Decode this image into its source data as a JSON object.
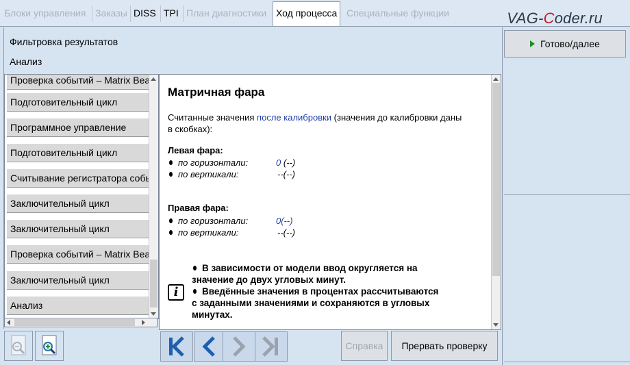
{
  "tabs": [
    {
      "label": "Блоки управления",
      "state": "disabled"
    },
    {
      "label": "Заказы",
      "state": "disabled"
    },
    {
      "label": "DISS",
      "state": "normal"
    },
    {
      "label": "TPI",
      "state": "normal"
    },
    {
      "label": "План диагностики",
      "state": "disabled"
    },
    {
      "label": "Ход процесса",
      "state": "active"
    },
    {
      "label": "Специальные функции",
      "state": "disabled"
    }
  ],
  "logo": {
    "prefix": "VAG-",
    "accent": "C",
    "suffix": "oder.ru"
  },
  "left_header": {
    "filter_label": "Фильтровка результатов",
    "analysis_label": "Анализ"
  },
  "list_items": [
    "Проверка событий – Matrix Beam",
    "Подготовительный цикл",
    "Программное управление",
    "Подготовительный цикл",
    "Считывание регистратора событий",
    "Заключительный цикл",
    "Заключительный цикл",
    "Проверка событий – Matrix Beam",
    "Заключительный цикл",
    "Анализ"
  ],
  "content": {
    "title": "Матричная фара",
    "intro_part1": "Считанные значения ",
    "intro_link": "после калибровки",
    "intro_part2": " (значения до калибровки даны",
    "intro_line2": "в скобках):",
    "left_heading": "Левая фара:",
    "left_h_label": "по горизонтали:",
    "left_h_value": "0",
    "left_h_prev": "(--)",
    "left_v_label": "по вертикали:",
    "left_v_value": "--(--)",
    "right_heading": "Правая фара:",
    "right_h_label": "по горизонтали:",
    "right_h_value": "0(--)",
    "right_v_label": "по вертикали:",
    "right_v_value": "--(--)",
    "note1_line1": "В зависимости от модели ввод округляется на",
    "note1_line2": "значение до двух угловых минут.",
    "note2_line1": "Введённые значения в процентах рассчитываются",
    "note2_line2": "с заданными значениями и сохраняются в угловых",
    "note2_line3": "минутах."
  },
  "buttons": {
    "help": "Справка",
    "abort": "Прервать проверку",
    "done": "Готово/далее"
  },
  "icons": {
    "zoom_out": "zoom-out-icon",
    "zoom_in": "zoom-in-icon",
    "first": "skip-to-first-icon",
    "prev": "previous-icon",
    "next": "next-icon",
    "last": "skip-to-last-icon",
    "info": "info-icon",
    "play": "play-icon"
  },
  "colors": {
    "accent_blue": "#1f3ea8",
    "play_green": "#1d8d1d",
    "logo_red": "#c0222b"
  }
}
